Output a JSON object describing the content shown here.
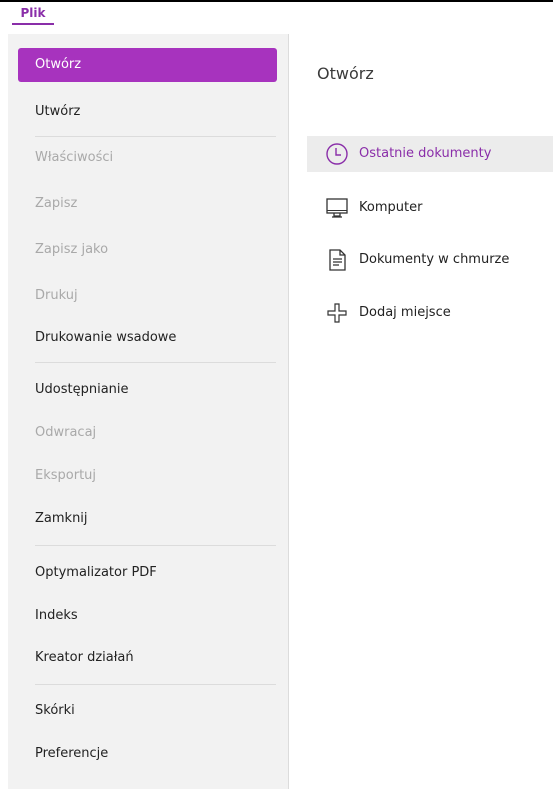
{
  "ribbon": {
    "file_tab": "Plik"
  },
  "sidebar": {
    "items": [
      {
        "label": "Otwórz",
        "state": "active"
      },
      {
        "label": "Utwórz",
        "state": "enabled"
      },
      {
        "label": "Właściwości",
        "state": "disabled"
      },
      {
        "label": "Zapisz",
        "state": "disabled"
      },
      {
        "label": "Zapisz jako",
        "state": "disabled"
      },
      {
        "label": "Drukuj",
        "state": "disabled"
      },
      {
        "label": "Drukowanie wsadowe",
        "state": "enabled"
      },
      {
        "label": "Udostępnianie",
        "state": "enabled"
      },
      {
        "label": "Odwracaj",
        "state": "disabled"
      },
      {
        "label": "Eksportuj",
        "state": "disabled"
      },
      {
        "label": "Zamknij",
        "state": "enabled"
      },
      {
        "label": "Optymalizator PDF",
        "state": "enabled"
      },
      {
        "label": "Indeks",
        "state": "enabled"
      },
      {
        "label": "Kreator działań",
        "state": "enabled"
      },
      {
        "label": "Skórki",
        "state": "enabled"
      },
      {
        "label": "Preferencje",
        "state": "enabled"
      }
    ]
  },
  "main": {
    "title": "Otwórz",
    "places": [
      {
        "label": "Ostatnie dokumenty",
        "icon": "clock-icon",
        "state": "active"
      },
      {
        "label": "Komputer",
        "icon": "monitor-icon",
        "state": "enabled"
      },
      {
        "label": "Dokumenty w chmurze",
        "icon": "document-icon",
        "state": "enabled"
      },
      {
        "label": "Dodaj miejsce",
        "icon": "plus-icon",
        "state": "enabled"
      }
    ]
  },
  "colors": {
    "accent": "#a733be",
    "accent_text": "#8a2ea9",
    "sidebar_bg": "#f2f2f2",
    "disabled_text": "#a9a9a9"
  }
}
